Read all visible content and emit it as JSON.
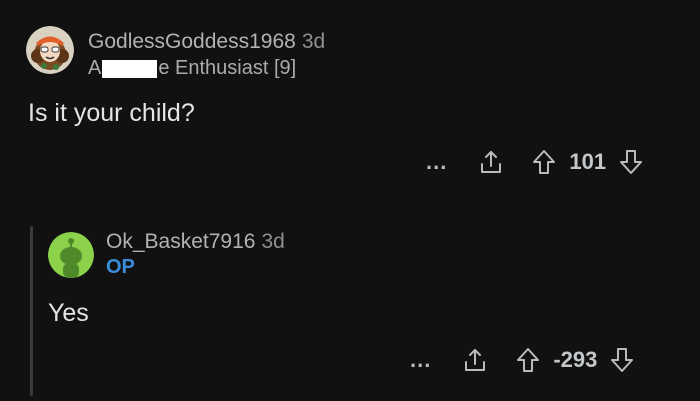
{
  "comments": [
    {
      "username": "GodlessGoddess1968",
      "time": "3d",
      "flair_prefix": "A",
      "flair_suffix": "e Enthusiast [9]",
      "body": "Is it your child?",
      "more_label": "...",
      "vote_count": "101"
    },
    {
      "username": "Ok_Basket7916",
      "time": "3d",
      "op_badge": "OP",
      "body": "Yes",
      "more_label": "...",
      "vote_count": "-293"
    }
  ],
  "colors": {
    "background": "#111111",
    "op_badge": "#3b8dd8",
    "avatar2_bg": "#8bd14a"
  },
  "icons": [
    "avatar-illustration",
    "snoo-avatar",
    "share-icon",
    "upvote-icon",
    "downvote-icon",
    "more-options-icon"
  ]
}
